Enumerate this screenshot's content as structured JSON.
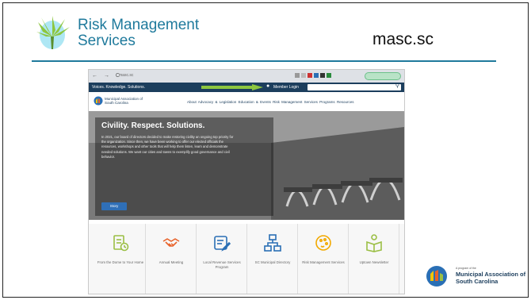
{
  "header": {
    "brand_line1": "Risk Management",
    "brand_line2": "Services",
    "site": "masc.sc"
  },
  "screenshot": {
    "browser": {
      "nav_glyphs": "← → C",
      "url": "masc.sc"
    },
    "topbar": {
      "tagline": "Voices. Knowledge. Solutions.",
      "member_login": "Member Login",
      "search_placeholder": ""
    },
    "site_header": {
      "org_name": "Municipal Association of South Carolina",
      "menu": [
        "About",
        "Advocacy & Legislation",
        "Education & Events",
        "Risk Management Services",
        "Programs",
        "Resources"
      ]
    },
    "hero": {
      "title": "Civility. Respect. Solutions.",
      "body": "In 2021, our board of directors decided to make restoring civility an ongoing top priority for the organization. Since then, we have been working to offer our elected officials the resources, workshops and other tools that will help them listen, learn and demonstrate needed solutions. We want our cities and towns to exemplify good governance and civil behavior.",
      "button": "Story"
    },
    "tiles": [
      {
        "icon": "document-icon",
        "label": "From the Dome to Your Home"
      },
      {
        "icon": "handshake-icon",
        "label": "Annual Meeting"
      },
      {
        "icon": "edit-icon",
        "label": "Local Revenue Services Program"
      },
      {
        "icon": "network-icon",
        "label": "SC Municipal Directory"
      },
      {
        "icon": "palette-icon",
        "label": "Risk Management Services"
      },
      {
        "icon": "book-person-icon",
        "label": "Uptown Newsletter"
      }
    ]
  },
  "footer_logo": {
    "small": "A program of the",
    "name": "Municipal Association of South Carolina"
  },
  "colors": {
    "brand_blue": "#1f7a9c",
    "navy": "#1c3e5d",
    "arrow_green": "#8dc63f",
    "tile_orange": "#e8622a",
    "tile_green": "#9bbf45"
  }
}
